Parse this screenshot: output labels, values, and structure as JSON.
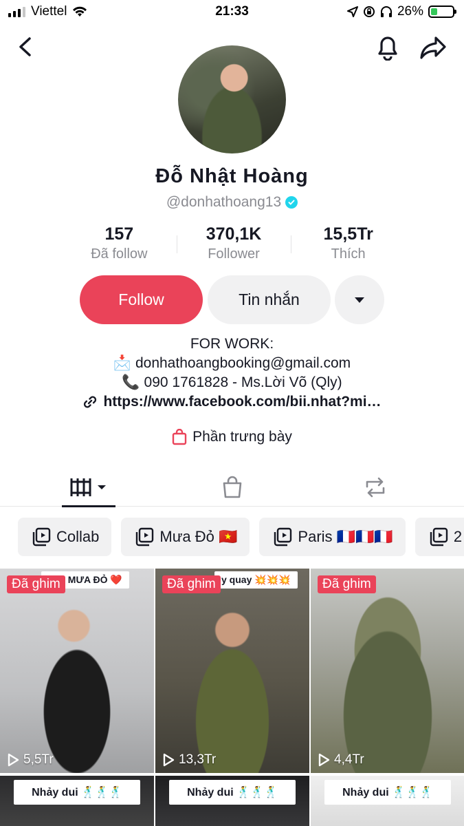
{
  "status_bar": {
    "carrier": "Viettel",
    "time": "21:33",
    "battery": "26%"
  },
  "profile": {
    "display_name": "Đỗ  Nhật  Hoàng",
    "username": "@donhathoang13",
    "stats": [
      {
        "value": "157",
        "label": "Đã follow"
      },
      {
        "value": "370,1K",
        "label": "Follower"
      },
      {
        "value": "15,5Tr",
        "label": "Thích"
      }
    ],
    "follow_label": "Follow",
    "message_label": "Tin nhắn",
    "bio": {
      "line1": "FOR WORK:",
      "email_emoji": "📩",
      "email": "donhathoangbooking@gmail.com",
      "phone_emoji": "📞",
      "phone": "090 1761828 - Ms.Lời Võ (Qly)"
    },
    "link": "https://www.facebook.com/bii.nhat?mi…",
    "showcase_label": "Phần trưng bày"
  },
  "playlists": [
    {
      "label": "Collab"
    },
    {
      "label": "Mưa Đỏ 🇻🇳"
    },
    {
      "label": "Paris 🇫🇷🇫🇷🇫🇷"
    },
    {
      "label": "2"
    }
  ],
  "videos": [
    {
      "pinned_label": "Đã ghim",
      "caption": "cho MƯA ĐỎ ❤️",
      "views": "5,5Tr"
    },
    {
      "pinned_label": "Đã ghim",
      "caption": "y quay 💥💥💥",
      "views": "13,3Tr"
    },
    {
      "pinned_label": "Đã ghim",
      "caption": "",
      "views": "4,4Tr"
    },
    {
      "caption": "Nhảy dui 🕺🕺🕺"
    },
    {
      "caption": "Nhảy dui 🕺🕺🕺"
    },
    {
      "caption": "Nhảy dui 🕺🕺🕺"
    }
  ],
  "colors": {
    "accent": "#ea4359",
    "verified": "#20d5ec",
    "muted": "#8a8b91"
  }
}
